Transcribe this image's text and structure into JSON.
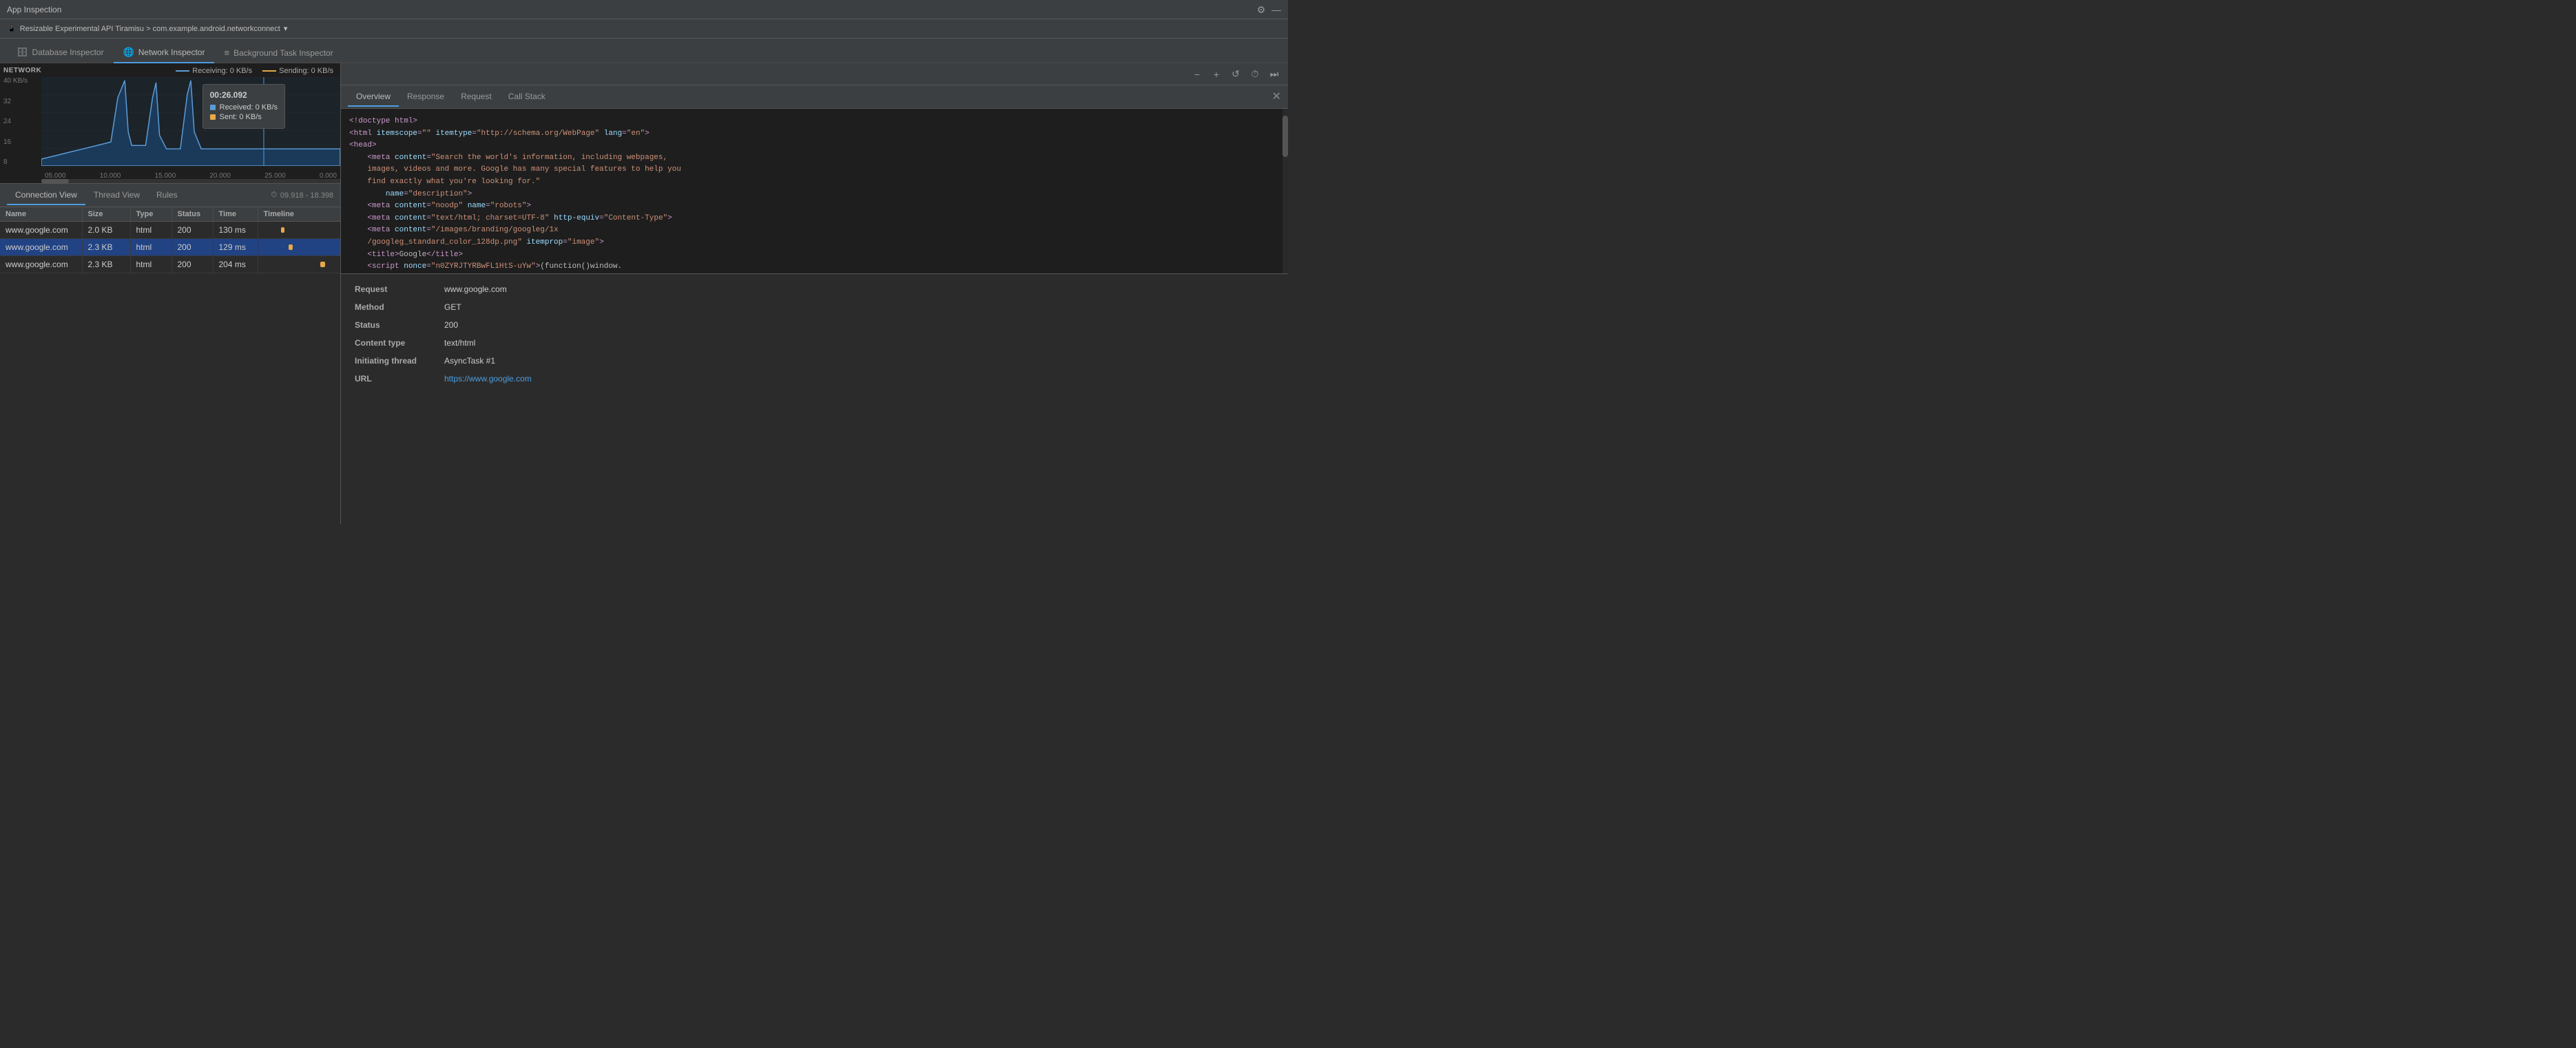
{
  "app": {
    "title": "App Inspection",
    "settings_icon": "⚙",
    "minimize_icon": "—"
  },
  "device_bar": {
    "icon": "📱",
    "label": "Resizable Experimental API Tiramisu > com.example.android.networkconnect",
    "dropdown_icon": "▾"
  },
  "tabs": [
    {
      "id": "database",
      "label": "Database Inspector",
      "icon": "🗄",
      "active": false
    },
    {
      "id": "network",
      "label": "Network Inspector",
      "icon": "🌐",
      "active": true
    },
    {
      "id": "background",
      "label": "Background Task Inspector",
      "icon": "≡",
      "active": false
    }
  ],
  "toolbar": {
    "icons": [
      "−",
      "+",
      "↺",
      "⏱",
      "⏭"
    ]
  },
  "chart": {
    "label": "NETWORK",
    "y_axis": [
      "40 KB/s",
      "32",
      "24",
      "16",
      "8"
    ],
    "x_axis": [
      "05.000",
      "10.000",
      "15.000",
      "20.000",
      "25.000",
      "0.000"
    ],
    "legend": {
      "receiving_label": "Receiving: 0 KB/s",
      "sending_label": "Sending: 0 KB/s"
    },
    "tooltip": {
      "time": "00:26.092",
      "received": "Received: 0 KB/s",
      "sent": "Sent: 0 KB/s"
    }
  },
  "connection_tabs": [
    {
      "id": "connection",
      "label": "Connection View",
      "active": true
    },
    {
      "id": "thread",
      "label": "Thread View",
      "active": false
    },
    {
      "id": "rules",
      "label": "Rules",
      "active": false
    }
  ],
  "time_range": {
    "icon": "⏱",
    "value": "09.918 - 18.398"
  },
  "table": {
    "headers": [
      "Name",
      "Size",
      "Type",
      "Status",
      "Time",
      "Timeline"
    ],
    "rows": [
      {
        "name": "www.google.com",
        "size": "2.0 KB",
        "type": "html",
        "status": "200",
        "time": "130 ms",
        "bar_left": "28%",
        "bar_width": "4%",
        "selected": false
      },
      {
        "name": "www.google.com",
        "size": "2.3 KB",
        "type": "html",
        "status": "200",
        "time": "129 ms",
        "bar_left": "37%",
        "bar_width": "5%",
        "selected": true
      },
      {
        "name": "www.google.com",
        "size": "2.3 KB",
        "type": "html",
        "status": "200",
        "time": "204 ms",
        "bar_left": "76%",
        "bar_width": "6%",
        "selected": false
      }
    ]
  },
  "detail_tabs": [
    {
      "id": "overview",
      "label": "Overview",
      "active": true
    },
    {
      "id": "response",
      "label": "Response",
      "active": false
    },
    {
      "id": "request",
      "label": "Request",
      "active": false
    },
    {
      "id": "callstack",
      "label": "Call Stack",
      "active": false
    }
  ],
  "code_preview": [
    "<!doctype html>",
    "<html itemscope=\"\" itemtype=\"http://schema.org/WebPage\" lang=\"en\">",
    "<head>",
    "    <meta content=\"Search the world's information, including webpages,",
    "    images, videos and more. Google has many special features to help you",
    "    find exactly what you're looking for.\"",
    "        name=\"description\">",
    "    <meta content=\"noodp\" name=\"robots\">",
    "    <meta content=\"text/html; charset=UTF-8\" http-equiv=\"Content-Type\">",
    "    <meta content=\"/images/branding/googleg/1x",
    "    /googleg_standard_color_128dp.png\" itemprop=\"image\">",
    "    <title>Google</title>",
    "    <script nonce=\"n0ZYRJTYRBwFL1HtS-uYw\">(function()window."
  ],
  "overview": {
    "request_label": "Request",
    "request_value": "www.google.com",
    "method_label": "Method",
    "method_value": "GET",
    "status_label": "Status",
    "status_value": "200",
    "content_type_label": "Content type",
    "content_type_value": "text/html",
    "initiating_thread_label": "Initiating thread",
    "initiating_thread_value": "AsyncTask #1",
    "url_label": "URL",
    "url_value": "https://www.google.com"
  }
}
